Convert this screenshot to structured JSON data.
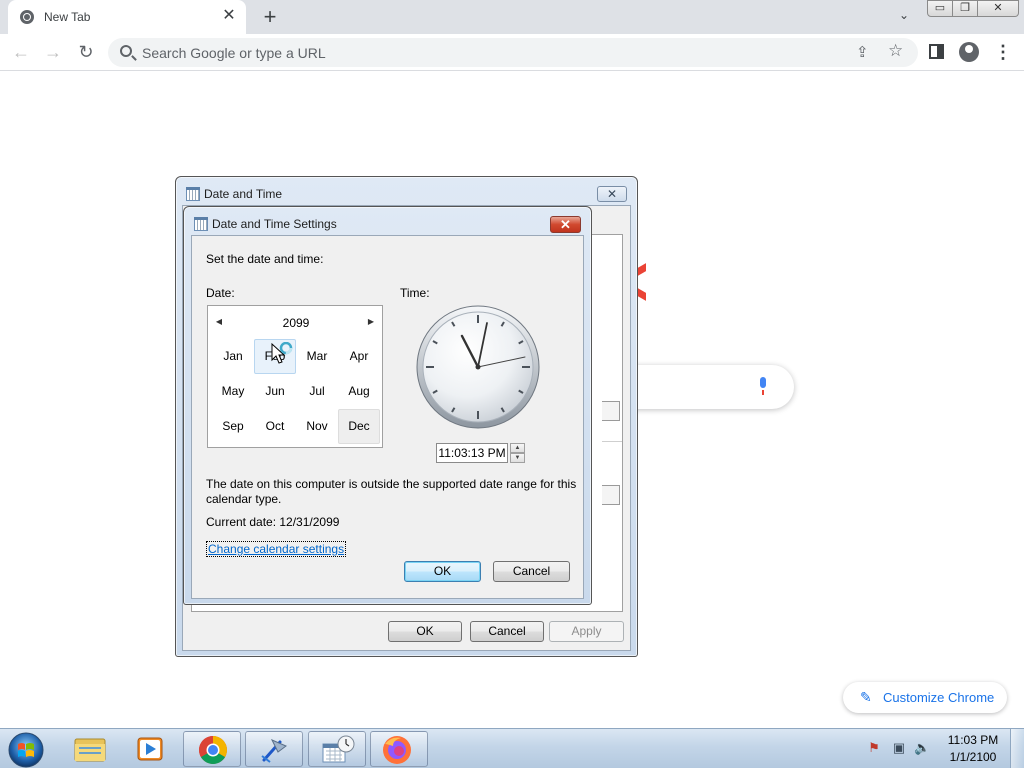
{
  "browser": {
    "tab_title": "New Tab",
    "tab_close": "✕",
    "new_tab": "+",
    "tab_search": "⌄",
    "win_min": "▭",
    "win_max": "❐",
    "win_close": "✕",
    "back": "←",
    "forward": "→",
    "reload": "↻",
    "omnibox_placeholder": "Search Google or type a URL",
    "share": "⇪",
    "bookmark": "☆",
    "menu": "⋮"
  },
  "ntp": {
    "customize_label": "Customize Chrome",
    "customize_icon": "✎"
  },
  "outer_dialog": {
    "title": "Date and Time",
    "close": "✕",
    "ok": "OK",
    "cancel": "Cancel",
    "apply": "Apply"
  },
  "inner_dialog": {
    "title": "Date and Time Settings",
    "close": "✕",
    "instruction": "Set the date and time:",
    "date_label": "Date:",
    "time_label": "Time:",
    "calendar": {
      "year": "2099",
      "prev": "◀",
      "next": "▶",
      "months": [
        "Jan",
        "Feb",
        "Mar",
        "Apr",
        "May",
        "Jun",
        "Jul",
        "Aug",
        "Sep",
        "Oct",
        "Nov",
        "Dec"
      ],
      "hovered_month": "Feb",
      "selected_month": "Dec"
    },
    "time_value": "11:03:13 PM",
    "spin_up": "▲",
    "spin_down": "▼",
    "warning_line1": "The date on this computer is outside the supported date range for this",
    "warning_line2": "calendar type.",
    "current_date": "Current date: 12/31/2099",
    "change_link": "Change calendar settings",
    "ok": "OK",
    "cancel": "Cancel"
  },
  "taskbar": {
    "apps": [
      "windows-explorer",
      "media-player",
      "google-chrome",
      "network-tool",
      "date-and-time",
      "firefox"
    ],
    "tray_flag": "⚑",
    "tray_network": "▣",
    "tray_volume": "🔈",
    "clock_time": "11:03 PM",
    "clock_date": "1/1/2100"
  }
}
